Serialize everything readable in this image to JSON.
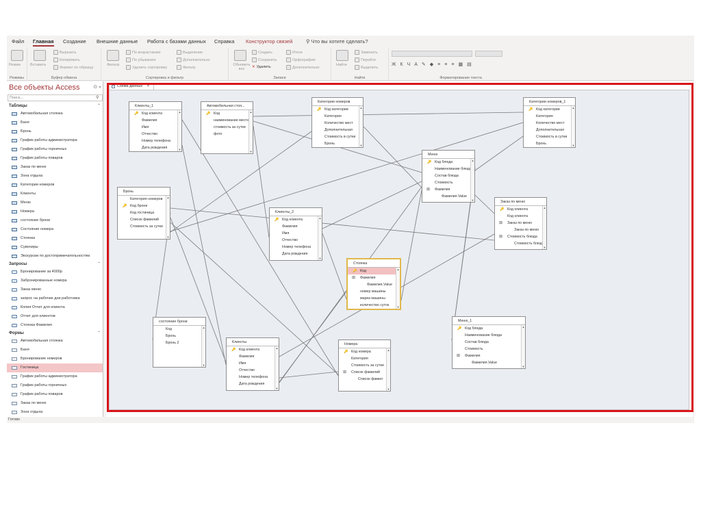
{
  "menu": {
    "tabs": [
      "Файл",
      "Главная",
      "Создание",
      "Внешние данные",
      "Работа с базами данных",
      "Справка",
      "Конструктор связей"
    ],
    "active_tab": "Главная",
    "tell_me": "Что вы хотите сделать?"
  },
  "ribbon": {
    "groups": {
      "views": "Режимы",
      "clipboard": "Буфер обмена",
      "sort_filter": "Сортировка и фильтр",
      "records": "Записи",
      "find": "Найти",
      "text_format": "Форматирование текста"
    },
    "buttons": {
      "view": "Режим",
      "paste": "Вставить",
      "cut": "Вырезать",
      "copy": "Копировать",
      "format_painter": "Формат по образцу",
      "filter": "Фильтр",
      "ascending": "По возрастанию",
      "descending": "По убыванию",
      "remove_sort": "Удалить сортировку",
      "selection": "Выделение",
      "advanced": "Дополнительно",
      "toggle_filter": "Фильтр",
      "refresh_all": "Обновить все",
      "new": "Создать",
      "save": "Сохранить",
      "delete": "Удалить",
      "totals": "Итоги",
      "spelling": "Орфография",
      "more": "Дополнительно",
      "find": "Найти",
      "replace": "Заменить",
      "goto": "Перейти",
      "select": "Выделить"
    }
  },
  "nav": {
    "title": "Все объекты Access",
    "search_placeholder": "Поиск...",
    "sections": [
      {
        "label": "Таблицы",
        "kind": "table",
        "items": [
          "Автомобильная стоянка",
          "Баня",
          "Бронь",
          "График работы администратора",
          "График работы горничных",
          "График работы поваров",
          "Заказ по меню",
          "Зона отдыха",
          "Категории номеров",
          "Клиенты",
          "Меню",
          "Номера",
          "состояние брони",
          "Состояние номера",
          "Стоянка",
          "Сувениры",
          "Экскурсии по достопримечательностям"
        ]
      },
      {
        "label": "Запросы",
        "kind": "query",
        "items": [
          "Бронирование за 4000р",
          "Забронированные номера",
          "Заказ меню",
          "запрос на рабочие дни работника",
          "Копия Отчет для клиента",
          "Отчет для клиентов",
          "Стоянка Фамилия"
        ]
      },
      {
        "label": "Формы",
        "kind": "form",
        "items": [
          "Автомобильная стоянка",
          "Баня",
          "Бронирование номеров",
          "Гостиница",
          "График работы администратора",
          "График работы горничных",
          "График работы поваров",
          "Заказ по меню",
          "Зона отдыха"
        ]
      }
    ]
  },
  "status": "Готово",
  "document": {
    "tab_label": "Схема данных",
    "tables": [
      {
        "id": "klienty1",
        "title": "Клиенты_1",
        "fields": [
          {
            "name": "Код клиента",
            "key": true
          },
          {
            "name": "Фамилия"
          },
          {
            "name": "Имя"
          },
          {
            "name": "Отчество"
          },
          {
            "name": "Номер телефона"
          },
          {
            "name": "Дата рождения"
          }
        ]
      },
      {
        "id": "avtostoyanka",
        "title": "Автомобильная стоя...",
        "fields": [
          {
            "name": "Код",
            "key": true
          },
          {
            "name": "наименование места"
          },
          {
            "name": "стоимость за сутки"
          },
          {
            "name": "фото"
          }
        ]
      },
      {
        "id": "kategorii",
        "title": "Категории номеров",
        "fields": [
          {
            "name": "Код категории",
            "key": true
          },
          {
            "name": "Категория"
          },
          {
            "name": "Количество мест"
          },
          {
            "name": "Дополнительная"
          },
          {
            "name": "Стоимость в сутки"
          },
          {
            "name": "Бронь"
          }
        ]
      },
      {
        "id": "kategorii1",
        "title": "Категории номеров_1",
        "fields": [
          {
            "name": "Код категории",
            "key": true
          },
          {
            "name": "Категория"
          },
          {
            "name": "Количество мест"
          },
          {
            "name": "Дополнительная"
          },
          {
            "name": "Стоимость в сутки"
          },
          {
            "name": "Бронь"
          }
        ]
      },
      {
        "id": "menu",
        "title": "Меню",
        "fields": [
          {
            "name": "Код блюда",
            "key": true
          },
          {
            "name": "Наименование блюда"
          },
          {
            "name": "Состав блюда"
          },
          {
            "name": "Стоимость"
          },
          {
            "name": "Фамилия",
            "expand": true
          },
          {
            "name": "Фамилия.Value",
            "sub": true
          }
        ]
      },
      {
        "id": "zakaz",
        "title": "Заказ по меню",
        "fields": [
          {
            "name": "Код клиента",
            "key": true
          },
          {
            "name": "Код клиента"
          },
          {
            "name": "Заказ по меню",
            "expand": true
          },
          {
            "name": "Заказ по меню",
            "sub": true
          },
          {
            "name": "Стоимость блюда",
            "expand": true
          },
          {
            "name": "Стоимость блюд",
            "sub": true
          }
        ]
      },
      {
        "id": "bron",
        "title": "Бронь",
        "fields": [
          {
            "name": "Категория номеров"
          },
          {
            "name": "Код брони",
            "key": true
          },
          {
            "name": "Код гостиница"
          },
          {
            "name": "Список фамилий"
          },
          {
            "name": "Стоимость за сутки"
          }
        ]
      },
      {
        "id": "klienty2",
        "title": "Клиенты_2",
        "fields": [
          {
            "name": "Код клиента",
            "key": true
          },
          {
            "name": "Фамилия"
          },
          {
            "name": "Имя"
          },
          {
            "name": "Отчество"
          },
          {
            "name": "Номер телефона"
          },
          {
            "name": "Дата рождения"
          }
        ]
      },
      {
        "id": "stoyanka",
        "title": "Стоянка",
        "fields": [
          {
            "name": "Код",
            "key": true,
            "highlight": true
          },
          {
            "name": "Фамилия",
            "expand": true
          },
          {
            "name": "Фамилия.Value",
            "sub": true
          },
          {
            "name": "номер машины"
          },
          {
            "name": "марка машины"
          },
          {
            "name": "количество суток"
          }
        ]
      },
      {
        "id": "sostoyanie",
        "title": "состояние брони",
        "fields": [
          {
            "name": "Код"
          },
          {
            "name": "Бронь"
          },
          {
            "name": "Бронь 2"
          }
        ]
      },
      {
        "id": "menu1",
        "title": "Меню_1",
        "fields": [
          {
            "name": "Код блюда",
            "key": true
          },
          {
            "name": "Наименование блюда"
          },
          {
            "name": "Состав блюда"
          },
          {
            "name": "Стоимость"
          },
          {
            "name": "Фамилия",
            "expand": true
          },
          {
            "name": "Фамилия.Value",
            "sub": true
          }
        ]
      },
      {
        "id": "klienty",
        "title": "Клиенты",
        "fields": [
          {
            "name": "Код клиента",
            "key": true
          },
          {
            "name": "Фамилия"
          },
          {
            "name": "Имя"
          },
          {
            "name": "Отчество"
          },
          {
            "name": "Номер телефона"
          },
          {
            "name": "Дата рождения"
          }
        ]
      },
      {
        "id": "nomera",
        "title": "Номера",
        "fields": [
          {
            "name": "Код номера",
            "key": true
          },
          {
            "name": "Категория"
          },
          {
            "name": "Стоимость за сутки"
          },
          {
            "name": "Список фамилий",
            "expand": true
          },
          {
            "name": "Список фамил",
            "sub": true
          }
        ]
      }
    ],
    "relationships": [
      [
        "avtostoyanka",
        "kategorii1"
      ],
      [
        "avtostoyanka",
        "menu"
      ],
      [
        "avtostoyanka",
        "klienty2"
      ],
      [
        "kategorii",
        "menu"
      ],
      [
        "kategorii",
        "bron"
      ],
      [
        "kategorii1",
        "menu"
      ],
      [
        "klienty1",
        "klienty"
      ],
      [
        "klienty1",
        "nomera"
      ],
      [
        "bron",
        "zakaz"
      ],
      [
        "bron",
        "sostoyanie"
      ],
      [
        "bron",
        "klienty"
      ],
      [
        "bron",
        "nomera"
      ],
      [
        "menu",
        "stoyanka"
      ],
      [
        "menu",
        "zakaz"
      ],
      [
        "menu",
        "menu1"
      ],
      [
        "klienty2",
        "menu"
      ],
      [
        "klienty2",
        "stoyanka"
      ],
      [
        "stoyanka",
        "klienty"
      ],
      [
        "zakaz",
        "klienty"
      ],
      [
        "klienty",
        "nomera"
      ],
      [
        "klienty",
        "menu"
      ],
      [
        "kategorii1",
        "bron"
      ],
      [
        "menu1",
        "menu"
      ]
    ]
  }
}
